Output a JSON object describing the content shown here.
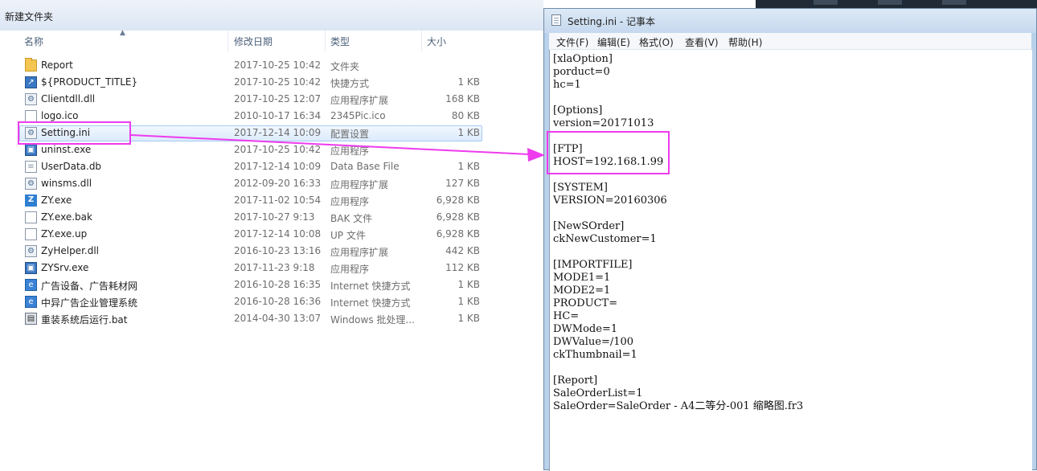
{
  "explorer": {
    "title": "新建文件夹",
    "columns": {
      "name": "名称",
      "date": "修改日期",
      "type": "类型",
      "size": "大小"
    },
    "files": [
      {
        "name": "Report",
        "date": "2017-10-25 10:42",
        "type": "文件夹",
        "size": "",
        "icon": "folder-icon"
      },
      {
        "name": "${PRODUCT_TITLE}",
        "date": "2017-10-25 10:42",
        "type": "快捷方式",
        "size": "1 KB",
        "icon": "shortcut-icon"
      },
      {
        "name": "Clientdll.dll",
        "date": "2017-10-25 12:07",
        "type": "应用程序扩展",
        "size": "168 KB",
        "icon": "dll-icon"
      },
      {
        "name": "logo.ico",
        "date": "2010-10-17 16:34",
        "type": "2345Pic.ico",
        "size": "80 KB",
        "icon": "image-icon"
      },
      {
        "name": "Setting.ini",
        "date": "2017-12-14 10:09",
        "type": "配置设置",
        "size": "1 KB",
        "icon": "settings-file-icon",
        "selected": true
      },
      {
        "name": "uninst.exe",
        "date": "2017-10-25 10:42",
        "type": "应用程序",
        "size": "",
        "icon": "exe-icon"
      },
      {
        "name": "UserData.db",
        "date": "2017-12-14 10:09",
        "type": "Data Base File",
        "size": "1 KB",
        "icon": "database-icon"
      },
      {
        "name": "winsms.dll",
        "date": "2012-09-20 16:33",
        "type": "应用程序扩展",
        "size": "127 KB",
        "icon": "dll-icon"
      },
      {
        "name": "ZY.exe",
        "date": "2017-11-02 10:54",
        "type": "应用程序",
        "size": "6,928 KB",
        "icon": "zy-app-icon"
      },
      {
        "name": "ZY.exe.bak",
        "date": "2017-10-27 9:13",
        "type": "BAK 文件",
        "size": "6,928 KB",
        "icon": "file-icon"
      },
      {
        "name": "ZY.exe.up",
        "date": "2017-12-14 10:08",
        "type": "UP 文件",
        "size": "6,928 KB",
        "icon": "file-icon"
      },
      {
        "name": "ZyHelper.dll",
        "date": "2016-10-23 13:16",
        "type": "应用程序扩展",
        "size": "442 KB",
        "icon": "dll-icon"
      },
      {
        "name": "ZYSrv.exe",
        "date": "2017-11-23 9:18",
        "type": "应用程序",
        "size": "112 KB",
        "icon": "exe-icon"
      },
      {
        "name": "广告设备、广告耗材网",
        "date": "2016-10-28 16:35",
        "type": "Internet 快捷方式",
        "size": "1 KB",
        "icon": "internet-shortcut-icon"
      },
      {
        "name": "中异广告企业管理系统",
        "date": "2016-10-28 16:36",
        "type": "Internet 快捷方式",
        "size": "1 KB",
        "icon": "internet-shortcut-icon"
      },
      {
        "name": "重装系统后运行.bat",
        "date": "2014-04-30 13:07",
        "type": "Windows 批处理...",
        "size": "1 KB",
        "icon": "batch-file-icon"
      }
    ]
  },
  "notepad": {
    "title": "Setting.ini - 记事本",
    "menu": [
      "文件(F)",
      "编辑(E)",
      "格式(O)",
      "查看(V)",
      "帮助(H)"
    ],
    "lines": [
      "[xlaOption]",
      "porduct=0",
      "hc=1",
      "",
      "[Options]",
      "version=20171013",
      "",
      "[FTP]",
      "HOST=192.168.1.99",
      "",
      "[SYSTEM]",
      "VERSION=20160306",
      "",
      "[NewSOrder]",
      "ckNewCustomer=1",
      "",
      "[IMPORTFILE]",
      "MODE1=1",
      "MODE2=1",
      "PRODUCT=",
      "HC=",
      "DWMode=1",
      "DWValue=/100",
      "ckThumbnail=1",
      "",
      "[Report]",
      "SaleOrderList=1",
      "SaleOrder=SaleOrder - A4二等分-001 缩略图.fr3"
    ]
  },
  "annotation": {
    "color": "#ee3bee"
  }
}
